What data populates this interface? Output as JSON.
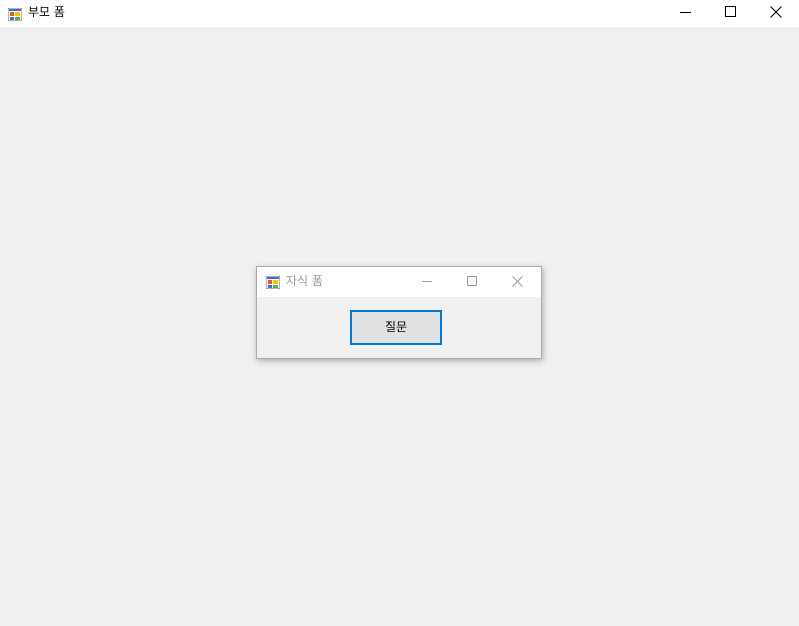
{
  "parent_window": {
    "title": "부모 폼",
    "icon": "winforms-app-icon",
    "caption_buttons": {
      "minimize": "minimize-icon",
      "maximize": "maximize-icon",
      "close": "close-icon"
    }
  },
  "child_window": {
    "title": "자식 폼",
    "icon": "winforms-app-icon",
    "caption_buttons": {
      "minimize": "minimize-icon",
      "maximize": "maximize-icon",
      "close": "close-icon"
    },
    "button_label": "질문"
  },
  "colors": {
    "client_background": "#f0f0f0",
    "titlebar_background": "#ffffff",
    "button_focus_border": "#0078d7",
    "button_face": "#e1e1e1",
    "inactive_title_text": "#999999"
  }
}
